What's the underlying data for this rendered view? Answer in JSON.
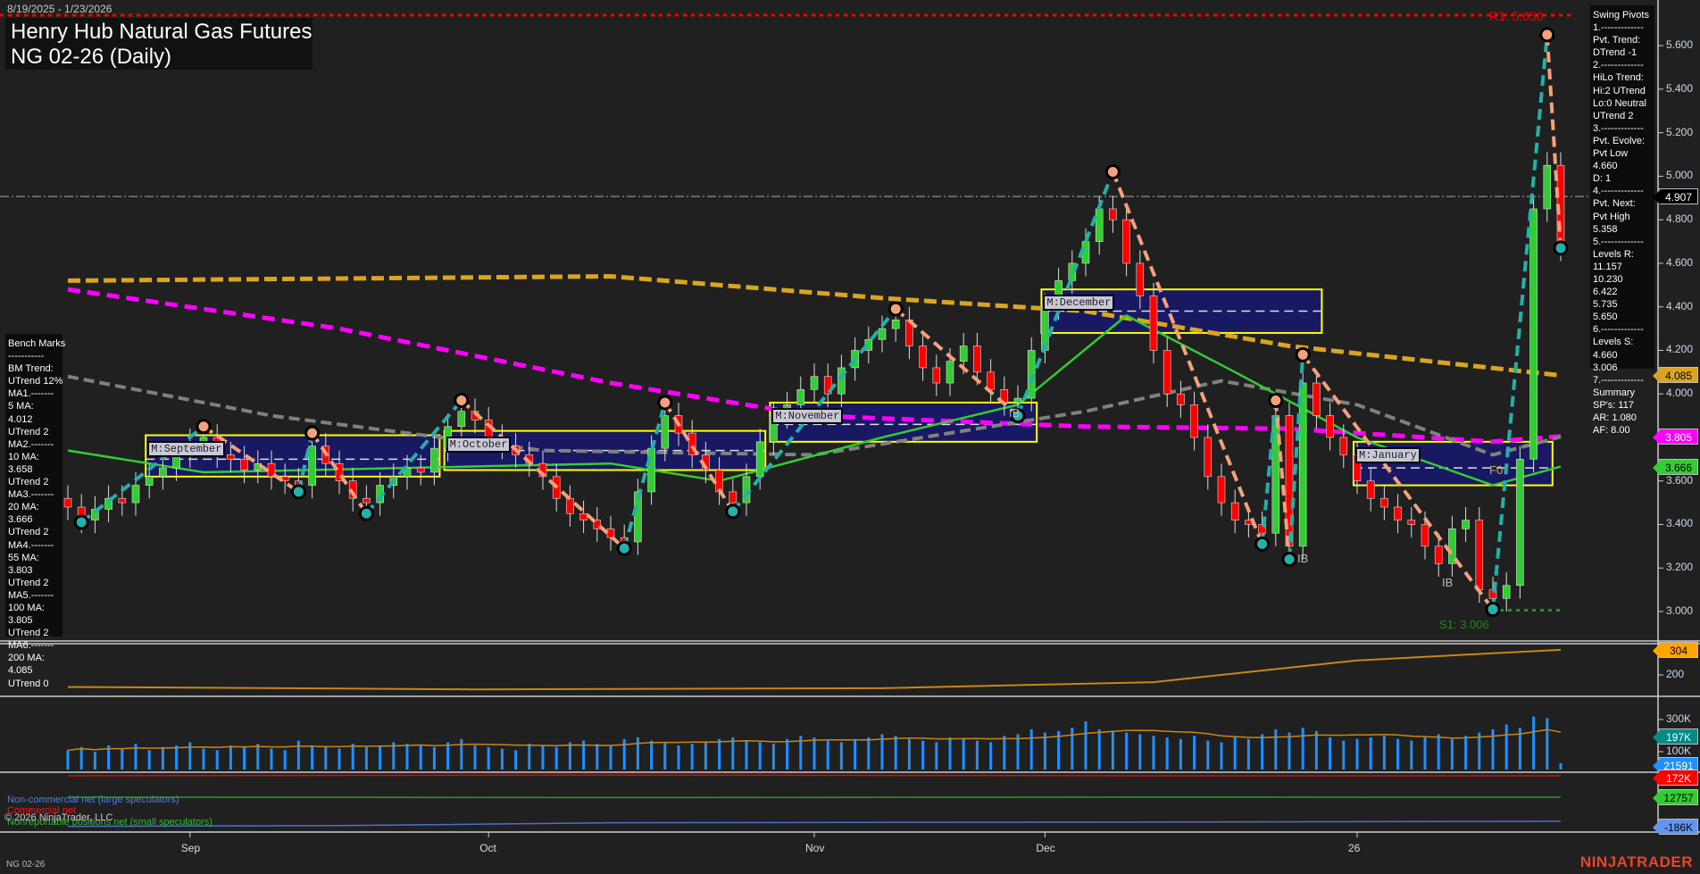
{
  "header": {
    "date_range": "8/19/2025 - 1/23/2026",
    "title": "Henry Hub Natural Gas Futures",
    "subtitle": "NG 02-26 (Daily)"
  },
  "bench_marks": [
    "Bench Marks",
    "-----------",
    "BM Trend:",
    "UTrend 12%",
    "MA1.-------",
    "5 MA:",
    "4.012",
    "UTrend 2",
    "MA2.-------",
    "10 MA:",
    "3.658",
    "UTrend 2",
    "MA3.-------",
    "20 MA:",
    "3.666",
    "UTrend 2",
    "MA4.-------",
    "55 MA:",
    "3.803",
    "UTrend 2",
    "MA5.-------",
    "100 MA:",
    "3.805",
    "UTrend 2",
    "MA6.-------",
    "200 MA:",
    "4.085",
    "UTrend 0"
  ],
  "swing_pivots": [
    "Swing Pivots",
    "1.-------------",
    "Pvt. Trend:",
    "DTrend -1",
    "2.-------------",
    "HiLo Trend:",
    "Hi:2 UTrend",
    "Lo:0 Neutral",
    "UTrend 2",
    "3.-------------",
    "Pvt. Evolve:",
    "Pvt Low",
    "4.660",
    "D: 1",
    "4.-------------",
    "Pvt. Next:",
    "Pvt High",
    "5.358",
    "5.-------------",
    "Levels R:",
    "11.157",
    "10.230",
    "6.422",
    "5.735",
    "5.650",
    "6.-------------",
    "Levels S:",
    "4.660",
    "3.006",
    "7.-------------",
    "Summary",
    "SP's: 117",
    "AR: 1.080",
    "AF: 8.00"
  ],
  "price_axis": {
    "ticks": [
      "5.600",
      "5.400",
      "5.200",
      "5.000",
      "4.800",
      "4.600",
      "4.400",
      "4.200",
      "4.000",
      "3.600",
      "3.400",
      "3.200",
      "3.000"
    ],
    "tags": [
      {
        "value": "4.907",
        "bg": "#000000",
        "fg": "#ffffff"
      },
      {
        "value": "4.085",
        "bg": "#daa520",
        "fg": "#000000"
      },
      {
        "value": "3.805",
        "bg": "#ff00ff",
        "fg": "#ffffff"
      },
      {
        "value": "3.666",
        "bg": "#32cd32",
        "fg": "#000000"
      }
    ]
  },
  "lower_axis": {
    "ticks": [
      "200",
      "300K",
      "100K"
    ],
    "tags": [
      {
        "value": "304",
        "bg": "#ffa500",
        "fg": "#000000"
      },
      {
        "value": "197K",
        "bg": "#008b8b",
        "fg": "#ffffff"
      },
      {
        "value": "21591",
        "bg": "#1e90ff",
        "fg": "#ffffff"
      },
      {
        "value": "172K",
        "bg": "#ff0000",
        "fg": "#ffffff"
      },
      {
        "value": "12757",
        "bg": "#32cd32",
        "fg": "#000000"
      },
      {
        "value": "-186K",
        "bg": "#6495ed",
        "fg": "#000000"
      }
    ]
  },
  "levels": {
    "r1_label": "R1: 5.650",
    "r1": 5.65,
    "s1_label": "S1: 3.006",
    "s1": 3.006,
    "last": 4.907
  },
  "month_boxes": [
    {
      "label": "M:September",
      "x0": 6,
      "x1": 27,
      "lo": 3.62,
      "hi": 3.81,
      "mid": 3.7
    },
    {
      "label": "M:October",
      "x0": 28,
      "x1": 51,
      "lo": 3.65,
      "hi": 3.83,
      "mid": 3.74
    },
    {
      "label": "M:November",
      "x0": 52,
      "x1": 71,
      "lo": 3.78,
      "hi": 3.96,
      "mid": 3.86
    },
    {
      "label": "M:December",
      "x0": 72,
      "x1": 92,
      "lo": 4.28,
      "hi": 4.48,
      "mid": 4.38
    },
    {
      "label": "M:January",
      "x0": 95,
      "x1": 109,
      "lo": 3.58,
      "hi": 3.78,
      "mid": 3.66
    }
  ],
  "annotations": [
    "IB",
    "IB",
    "IB",
    "F0"
  ],
  "x_axis": {
    "labels": [
      {
        "text": "Sep",
        "bar": 9
      },
      {
        "text": "Oct",
        "bar": 31
      },
      {
        "text": "Nov",
        "bar": 55
      },
      {
        "text": "Dec",
        "bar": 72
      },
      {
        "text": "26",
        "bar": 95
      }
    ]
  },
  "legend": {
    "noncommercial": "Non-commercial net (large speculators)",
    "commercial": "Commercial net",
    "nonreportable": "Nonreportable positions net (small speculators)",
    "copyright": "© 2026 NinjaTrader, LLC"
  },
  "footer": {
    "instrument": "NG 02-26",
    "logo": "NINJATRADER"
  },
  "colors": {
    "up": "#32cd32",
    "down": "#ff0000",
    "ma200": "#daa520",
    "ma100": "#ff00ff",
    "ma55": "#808080",
    "ma20": "#32cd32",
    "pivot_up": "#20b2aa",
    "pivot_down": "#f4a07a",
    "box": "#191970",
    "box_border": "#ffff00"
  },
  "chart_data": {
    "type": "candlestick",
    "title": "NG 02-26 (Daily)",
    "ylim": [
      2.85,
      5.75
    ],
    "closes": [
      3.48,
      3.42,
      3.47,
      3.52,
      3.5,
      3.58,
      3.62,
      3.66,
      3.72,
      3.78,
      3.8,
      3.72,
      3.7,
      3.65,
      3.68,
      3.62,
      3.6,
      3.58,
      3.76,
      3.68,
      3.6,
      3.52,
      3.5,
      3.58,
      3.62,
      3.66,
      3.64,
      3.75,
      3.85,
      3.92,
      3.88,
      3.8,
      3.76,
      3.72,
      3.68,
      3.62,
      3.52,
      3.45,
      3.42,
      3.38,
      3.34,
      3.32,
      3.55,
      3.75,
      3.9,
      3.82,
      3.72,
      3.65,
      3.55,
      3.5,
      3.62,
      3.78,
      3.9,
      3.95,
      4.02,
      4.08,
      4.0,
      4.12,
      4.2,
      4.25,
      4.3,
      4.34,
      4.22,
      4.12,
      4.05,
      4.15,
      4.22,
      4.1,
      4.02,
      3.96,
      3.98,
      4.2,
      4.4,
      4.52,
      4.6,
      4.7,
      4.85,
      4.8,
      4.6,
      4.45,
      4.2,
      4.0,
      3.95,
      3.8,
      3.62,
      3.5,
      3.42,
      3.4,
      3.36,
      3.9,
      3.3,
      4.05,
      3.9,
      3.8,
      3.72,
      3.6,
      3.52,
      3.48,
      3.42,
      3.4,
      3.3,
      3.22,
      3.38,
      3.42,
      3.1,
      3.06,
      3.12,
      3.7,
      4.85,
      5.05,
      4.67
    ],
    "pivots": [
      [
        1,
        3.41,
        "L"
      ],
      [
        10,
        3.85,
        "H"
      ],
      [
        17,
        3.55,
        "L"
      ],
      [
        18,
        3.82,
        "H"
      ],
      [
        22,
        3.45,
        "L"
      ],
      [
        29,
        3.97,
        "H"
      ],
      [
        41,
        3.29,
        "L"
      ],
      [
        44,
        3.96,
        "H"
      ],
      [
        49,
        3.46,
        "L"
      ],
      [
        61,
        4.39,
        "H"
      ],
      [
        70,
        3.9,
        "L"
      ],
      [
        77,
        5.02,
        "H"
      ],
      [
        88,
        3.31,
        "L"
      ],
      [
        89,
        3.97,
        "H"
      ],
      [
        90,
        3.24,
        "L"
      ],
      [
        91,
        4.18,
        "H"
      ],
      [
        105,
        3.01,
        "L"
      ],
      [
        109,
        5.65,
        "H"
      ],
      [
        110,
        4.67,
        "L"
      ]
    ],
    "ma200": [
      [
        0,
        4.52
      ],
      [
        20,
        4.53
      ],
      [
        40,
        4.54
      ],
      [
        60,
        4.44
      ],
      [
        75,
        4.38
      ],
      [
        90,
        4.22
      ],
      [
        110,
        4.085
      ]
    ],
    "ma100": [
      [
        0,
        4.48
      ],
      [
        20,
        4.3
      ],
      [
        40,
        4.05
      ],
      [
        55,
        3.9
      ],
      [
        75,
        3.85
      ],
      [
        90,
        3.84
      ],
      [
        105,
        3.78
      ],
      [
        110,
        3.805
      ]
    ],
    "ma55": [
      [
        0,
        4.08
      ],
      [
        15,
        3.9
      ],
      [
        35,
        3.74
      ],
      [
        55,
        3.72
      ],
      [
        75,
        3.92
      ],
      [
        85,
        4.06
      ],
      [
        95,
        3.95
      ],
      [
        105,
        3.72
      ],
      [
        110,
        3.803
      ]
    ],
    "ma20": [
      [
        0,
        3.74
      ],
      [
        10,
        3.64
      ],
      [
        25,
        3.66
      ],
      [
        40,
        3.68
      ],
      [
        48,
        3.6
      ],
      [
        60,
        3.8
      ],
      [
        70,
        3.95
      ],
      [
        78,
        4.36
      ],
      [
        86,
        4.1
      ],
      [
        95,
        3.8
      ],
      [
        105,
        3.58
      ],
      [
        110,
        3.666
      ]
    ],
    "osc": {
      "name": "panel2",
      "values": [
        [
          0,
          150
        ],
        [
          30,
          140
        ],
        [
          60,
          145
        ],
        [
          80,
          170
        ],
        [
          95,
          260
        ],
        [
          105,
          290
        ],
        [
          110,
          304
        ]
      ]
    },
    "volume_k": [
      120,
      140,
      110,
      150,
      130,
      160,
      120,
      140,
      150,
      170,
      130,
      120,
      150,
      140,
      160,
      130,
      120,
      180,
      150,
      140,
      130,
      160,
      140,
      150,
      170,
      160,
      150,
      140,
      170,
      190,
      150,
      140,
      130,
      120,
      160,
      150,
      140,
      170,
      180,
      160,
      150,
      190,
      200,
      180,
      170,
      150,
      160,
      170,
      190,
      200,
      180,
      170,
      160,
      190,
      210,
      200,
      180,
      170,
      190,
      200,
      220,
      210,
      190,
      180,
      170,
      200,
      190,
      180,
      170,
      210,
      220,
      250,
      230,
      240,
      260,
      300,
      250,
      240,
      230,
      220,
      210,
      200,
      190,
      210,
      180,
      170,
      200,
      190,
      220,
      250,
      230,
      260,
      240,
      200,
      180,
      190,
      200,
      210,
      190,
      180,
      200,
      220,
      190,
      210,
      230,
      250,
      280,
      260,
      330,
      320,
      40
    ],
    "cot": {
      "commercial": [
        [
          0,
          172
        ],
        [
          40,
          175
        ],
        [
          80,
          172
        ],
        [
          110,
          172
        ]
      ],
      "nonreportable": [
        [
          0,
          13
        ],
        [
          40,
          12
        ],
        [
          80,
          13
        ],
        [
          110,
          12.757
        ]
      ],
      "noncommercial": [
        [
          0,
          -200
        ],
        [
          20,
          -198
        ],
        [
          40,
          -190
        ],
        [
          80,
          -188
        ],
        [
          110,
          -186
        ]
      ]
    }
  }
}
